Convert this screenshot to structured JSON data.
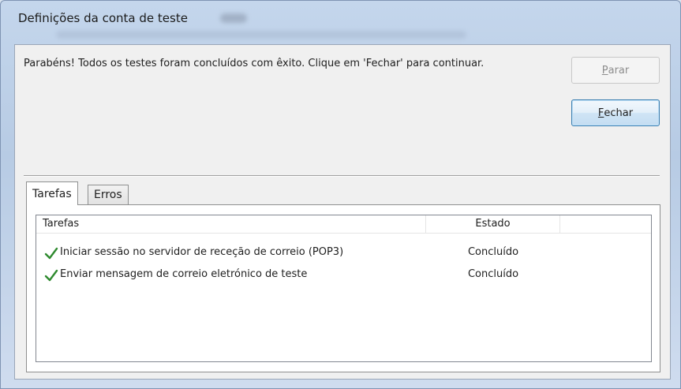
{
  "window": {
    "title": "Definições da conta de teste"
  },
  "message": "Parabéns! Todos os testes foram concluídos com êxito. Clique em 'Fechar' para continuar.",
  "buttons": {
    "stop": {
      "accel": "P",
      "rest": "arar"
    },
    "close": {
      "accel": "F",
      "rest": "echar"
    }
  },
  "tabs": [
    {
      "label": "Tarefas",
      "active": true
    },
    {
      "label": "Erros",
      "active": false
    }
  ],
  "table": {
    "columns": [
      "Tarefas",
      "Estado",
      ""
    ],
    "rows": [
      {
        "task": "Iniciar sessão no servidor de receção de correio (POP3)",
        "status": "Concluído",
        "icon": "check-icon"
      },
      {
        "task": "Enviar mensagem de correio eletrónico de teste",
        "status": "Concluído",
        "icon": "check-icon"
      }
    ]
  },
  "colors": {
    "check": "#2f8a2f",
    "accent_border": "#3c7fb1"
  }
}
